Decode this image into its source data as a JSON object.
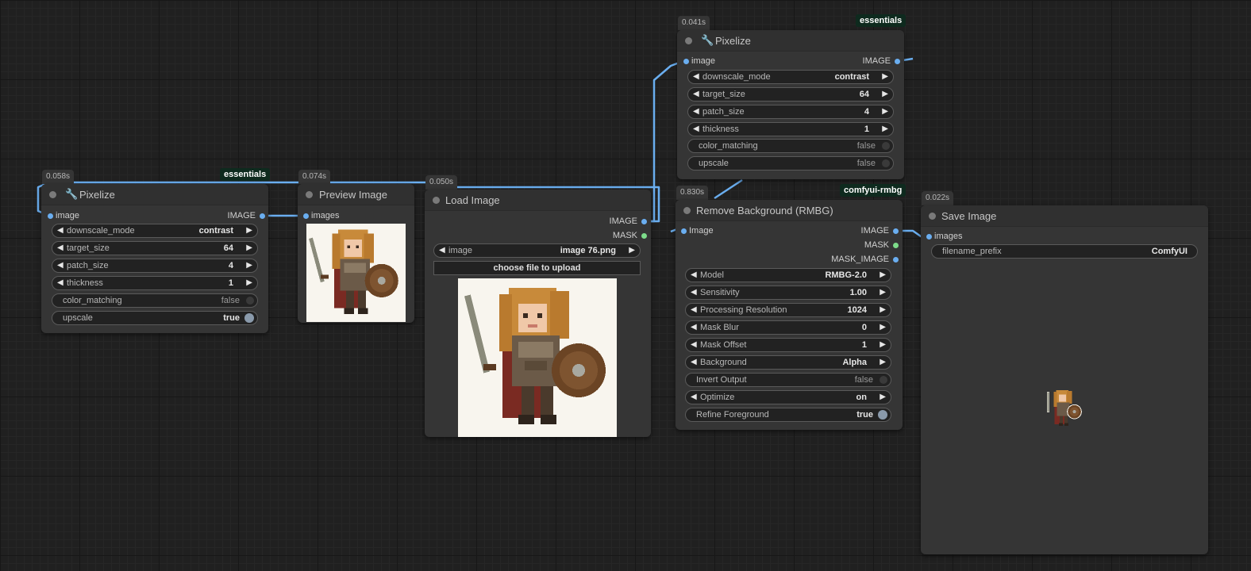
{
  "nodes": {
    "pixelize_left": {
      "timer": "0.058s",
      "badge": "essentials",
      "title": "Pixelize",
      "input": "image",
      "output": "IMAGE",
      "widgets": [
        {
          "label": "downscale_mode",
          "value": "contrast"
        },
        {
          "label": "target_size",
          "value": "64"
        },
        {
          "label": "patch_size",
          "value": "4"
        },
        {
          "label": "thickness",
          "value": "1"
        }
      ],
      "toggles": [
        {
          "label": "color_matching",
          "value": "false"
        },
        {
          "label": "upscale",
          "value": "true"
        }
      ]
    },
    "preview_image": {
      "timer": "0.074s",
      "title": "Preview Image",
      "input": "images"
    },
    "load_image": {
      "timer": "0.050s",
      "title": "Load Image",
      "outputs": [
        "IMAGE",
        "MASK"
      ],
      "image_label": "image",
      "image_value": "image 76.png",
      "upload_button": "choose file to upload"
    },
    "pixelize_top": {
      "timer": "0.041s",
      "badge": "essentials",
      "title": "Pixelize",
      "input": "image",
      "output": "IMAGE",
      "widgets": [
        {
          "label": "downscale_mode",
          "value": "contrast"
        },
        {
          "label": "target_size",
          "value": "64"
        },
        {
          "label": "patch_size",
          "value": "4"
        },
        {
          "label": "thickness",
          "value": "1"
        }
      ],
      "toggles": [
        {
          "label": "color_matching",
          "value": "false"
        },
        {
          "label": "upscale",
          "value": "false"
        }
      ]
    },
    "remove_background": {
      "timer": "0.830s",
      "badge": "comfyui-rmbg",
      "title": "Remove Background (RMBG)",
      "input": "Image",
      "outputs": [
        "IMAGE",
        "MASK",
        "MASK_IMAGE"
      ],
      "widgets": [
        {
          "label": "Model",
          "value": "RMBG-2.0"
        },
        {
          "label": "Sensitivity",
          "value": "1.00"
        },
        {
          "label": "Processing Resolution",
          "value": "1024"
        },
        {
          "label": "Mask Blur",
          "value": "0"
        },
        {
          "label": "Mask Offset",
          "value": "1"
        },
        {
          "label": "Background",
          "value": "Alpha"
        }
      ],
      "toggle_invert": {
        "label": "Invert Output",
        "value": "false"
      },
      "widget_optimize": {
        "label": "Optimize",
        "value": "on"
      },
      "toggle_refine": {
        "label": "Refine Foreground",
        "value": "true"
      }
    },
    "save_image": {
      "timer": "0.022s",
      "title": "Save Image",
      "input": "images",
      "text_widget": {
        "label": "filename_prefix",
        "value": "ComfyUI"
      }
    }
  },
  "colors": {
    "canvas": "#202020",
    "node_body": "#353535",
    "link_image": "#6aaef0",
    "slot_mask": "#7ddc8a",
    "badge_bg": "#0e2a1e"
  }
}
